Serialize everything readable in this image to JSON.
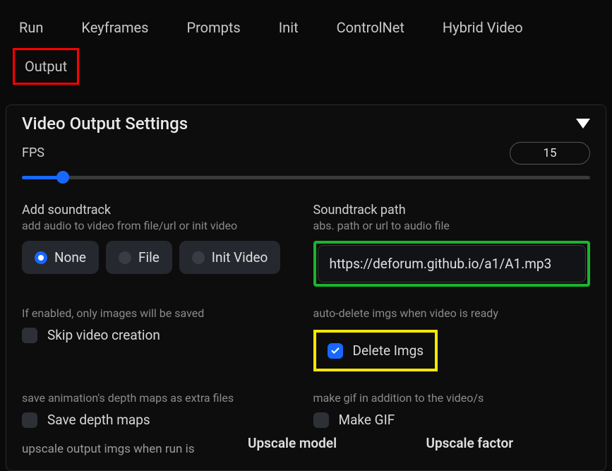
{
  "tabs": {
    "run": "Run",
    "keyframes": "Keyframes",
    "prompts": "Prompts",
    "init": "Init",
    "controlnet": "ControlNet",
    "hybrid": "Hybrid Video",
    "output": "Output"
  },
  "panel": {
    "title": "Video Output Settings"
  },
  "fps": {
    "label": "FPS",
    "value": "15"
  },
  "soundtrack": {
    "label": "Add soundtrack",
    "sub": "add audio to video from file/url or init video",
    "options": {
      "none": "None",
      "file": "File",
      "init": "Init Video"
    },
    "path_label": "Soundtrack path",
    "path_sub": "abs. path or url to audio file",
    "path_value": "https://deforum.github.io/a1/A1.mp3"
  },
  "skip": {
    "sub": "If enabled, only images will be saved",
    "label": "Skip video creation"
  },
  "delete": {
    "sub": "auto-delete imgs when video is ready",
    "label": "Delete Imgs"
  },
  "depth": {
    "sub": "save animation's depth maps as extra files",
    "label": "Save depth maps"
  },
  "gif": {
    "sub": "make gif in addition to the video/s",
    "label": "Make GIF"
  },
  "upscale": {
    "sub": "upscale output imgs when run is",
    "model_label": "Upscale model",
    "factor_label": "Upscale factor"
  }
}
